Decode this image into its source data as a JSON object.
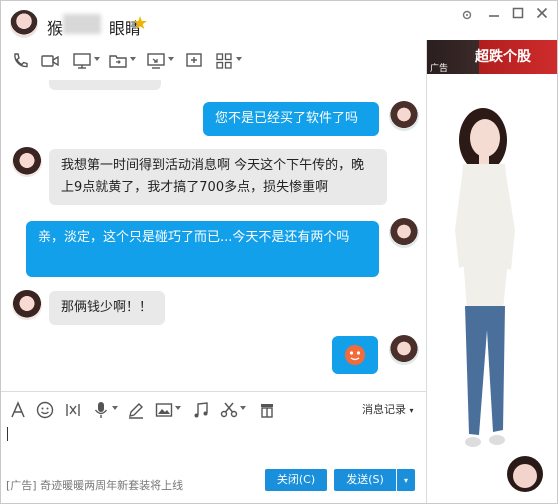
{
  "header": {
    "contact_name_prefix": "猴",
    "contact_name_suffix": "眼睛",
    "star_icon": "star-icon",
    "window_controls": {
      "settings": "gear-icon",
      "minimize": "minimize-icon",
      "maximize": "maximize-icon",
      "close": "close-icon"
    }
  },
  "toolbar": {
    "icons": [
      "phone-icon",
      "video-icon",
      "screen-share-icon",
      "file-transfer-icon",
      "remote-desktop-icon",
      "add-icon",
      "apps-icon"
    ]
  },
  "chat": {
    "messages": [
      {
        "side": "right",
        "text": "您不是已经买了软件了吗"
      },
      {
        "side": "left",
        "text": "我想第一时间得到活动消息啊 今天这个下午传的，晚上9点就黄了，我才搞了700多点，损失惨重啊"
      },
      {
        "side": "right",
        "text": "亲，淡定，这个只是碰巧了而已...今天不是还有两个吗"
      },
      {
        "side": "left",
        "text": "那俩钱少啊！！"
      },
      {
        "side": "right",
        "emoji": "emoji-face-icon"
      }
    ]
  },
  "input_toolbar": {
    "icons": [
      "font-icon",
      "smiley-icon",
      "screenshot-icon",
      "voice-icon",
      "pen-icon",
      "image-icon",
      "music-icon",
      "scissors-icon",
      "gift-icon"
    ],
    "history_label": "消息记录"
  },
  "side_panel": {
    "ad_label": "广告",
    "ad_text": "超跌个股"
  },
  "footer": {
    "ad_text": "[广告] 奇迹暖暖两周年新套装将上线",
    "close_label": "关闭(C)",
    "send_label": "发送(S)"
  },
  "colors": {
    "accent": "#12a0ea",
    "button": "#1a8fdc",
    "bubble_left": "#e9e9e9",
    "ad_red": "#cf2c2c"
  }
}
